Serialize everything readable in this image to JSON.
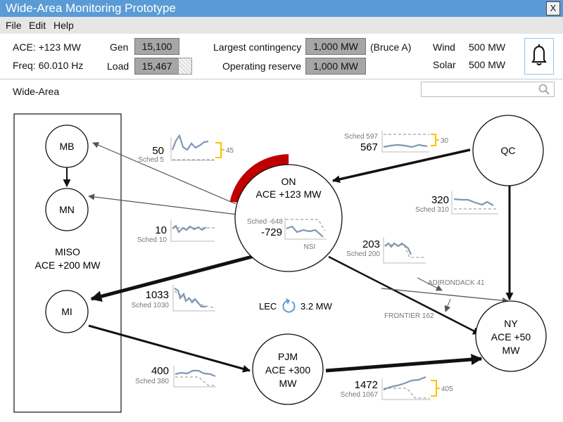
{
  "window": {
    "title": "Wide-Area Monitoring Prototype",
    "close_label": "X"
  },
  "menu": [
    "File",
    "Edit",
    "Help"
  ],
  "info": {
    "ace": "ACE: +123 MW",
    "freq": "Freq: 60.010 Hz",
    "gen_label": "Gen",
    "gen_value": "15,100",
    "load_label": "Load",
    "load_value": "15,467",
    "largest_label": "Largest contingency",
    "largest_value": "1,000 MW",
    "largest_note": "(Bruce A)",
    "reserve_label": "Operating reserve",
    "reserve_value": "1,000 MW",
    "wind_label": "Wind",
    "wind_value": "500 MW",
    "solar_label": "Solar",
    "solar_value": "500 MW"
  },
  "section_label": "Wide-Area",
  "search": {
    "placeholder": ""
  },
  "nodes": {
    "mb": "MB",
    "mn": "MN",
    "mi": "MI",
    "miso_name": "MISO",
    "miso_ace": "ACE +200 MW",
    "on_name": "ON",
    "on_ace": "ACE +123 MW",
    "qc": "QC",
    "ny_name": "NY",
    "ny_ace": "ACE +50",
    "ny_unit": "MW",
    "pjm_name": "PJM",
    "pjm_ace": "ACE +300",
    "pjm_unit": "MW"
  },
  "flows": {
    "mb": {
      "value": "50",
      "sched": "Sched 5",
      "dev": "45"
    },
    "mn": {
      "value": "10",
      "sched": "Sched 10"
    },
    "mi": {
      "value": "1033",
      "sched": "Sched 1030"
    },
    "pjm_in": {
      "value": "400",
      "sched": "Sched 380"
    },
    "pjm_ny": {
      "value": "1472",
      "sched": "Sched 1067",
      "dev": "405"
    },
    "qc": {
      "value": "567",
      "sched": "Sched 597",
      "dev": "30"
    },
    "qc_ny": {
      "value": "320",
      "sched": "Sched 310"
    },
    "on_ny": {
      "value": "203",
      "sched": "Sched 200"
    },
    "nsi": {
      "value": "-729",
      "sched": "Sched -648",
      "label": "NSI"
    }
  },
  "interfaces": {
    "adirondack": "ADIRONDACK 41",
    "frontier": "FRONTIER 162"
  },
  "lec": {
    "label": "LEC",
    "value": "3.2 MW"
  },
  "colors": {
    "titlebar": "#5b9bd5",
    "alert": "#c00000",
    "deviation": "#ffc000",
    "trend": "#7f97b5",
    "sched": "#8c8c8c",
    "lec_icon": "#5b9bd5"
  }
}
